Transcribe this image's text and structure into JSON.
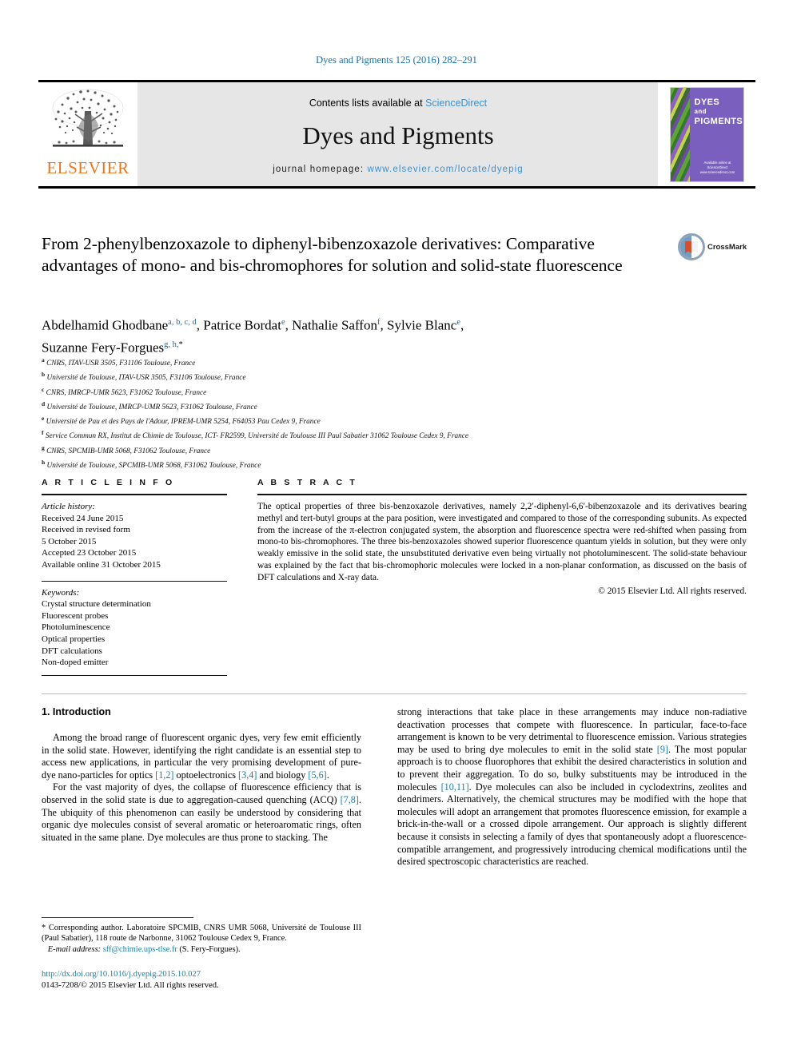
{
  "running_head": "Dyes and Pigments 125 (2016) 282–291",
  "masthead": {
    "publisher": "ELSEVIER",
    "contents_prefix": "Contents lists available at ",
    "contents_link": "ScienceDirect",
    "journal_name": "Dyes and Pigments",
    "homepage_prefix": "journal homepage: ",
    "homepage_url": "www.elsevier.com/locate/dyepig",
    "cover": {
      "line1": "DYES",
      "line2": "and",
      "line3": "PIGMENTS",
      "footer": "Available online at\nScienceDirect\nwww.sciencedirect.com"
    }
  },
  "article": {
    "title": "From 2-phenylbenzoxazole to diphenyl-bibenzoxazole derivatives: Comparative advantages of mono- and bis-chromophores for solution and solid-state fluorescence",
    "crossmark_label": "CrossMark",
    "authors_line1": "Abdelhamid Ghodbane",
    "authors_sup1": "a, b, c, d",
    "authors_line2": "Patrice Bordat",
    "authors_sup2": "e",
    "authors_line3": "Nathalie Saffon",
    "authors_sup3": "f",
    "authors_line4": "Sylvie Blanc",
    "authors_sup4": "e",
    "authors_line5": "Suzanne Fery-Forgues",
    "authors_sup5": "g, h,",
    "affiliations": [
      {
        "mark": "a",
        "text": "CNRS, ITAV-USR 3505, F31106 Toulouse, France"
      },
      {
        "mark": "b",
        "text": "Université de Toulouse, ITAV-USR 3505, F31106 Toulouse, France"
      },
      {
        "mark": "c",
        "text": "CNRS, IMRCP-UMR 5623, F31062 Toulouse, France"
      },
      {
        "mark": "d",
        "text": "Université de Toulouse, IMRCP-UMR 5623, F31062 Toulouse, France"
      },
      {
        "mark": "e",
        "text": "Université de Pau et des Pays de l'Adour, IPREM-UMR 5254, F64053 Pau Cedex 9, France"
      },
      {
        "mark": "f",
        "text": "Service Commun RX, Institut de Chimie de Toulouse, ICT- FR2599, Université de Toulouse III Paul Sabatier 31062 Toulouse Cedex 9, France"
      },
      {
        "mark": "g",
        "text": "CNRS, SPCMIB-UMR 5068, F31062 Toulouse, France"
      },
      {
        "mark": "h",
        "text": "Université de Toulouse, SPCMIB-UMR 5068, F31062 Toulouse, France"
      }
    ]
  },
  "article_info": {
    "heading": "A R T I C L E  I N F O",
    "history_title": "Article history:",
    "history": [
      "Received 24 June 2015",
      "Received in revised form",
      "5 October 2015",
      "Accepted 23 October 2015",
      "Available online 31 October 2015"
    ],
    "keywords_title": "Keywords:",
    "keywords": [
      "Crystal structure determination",
      "Fluorescent probes",
      "Photoluminescence",
      "Optical properties",
      "DFT calculations",
      "Non-doped emitter"
    ]
  },
  "abstract": {
    "heading": "A B S T R A C T",
    "text": "The optical properties of three bis-benzoxazole derivatives, namely 2,2′-diphenyl-6,6′-bibenzoxazole and its derivatives bearing methyl and tert-butyl groups at the para position, were investigated and compared to those of the corresponding subunits. As expected from the increase of the π-electron conjugated system, the absorption and fluorescence spectra were red-shifted when passing from mono-to bis-chromophores. The three bis-benzoxazoles showed superior fluorescence quantum yields in solution, but they were only weakly emissive in the solid state, the unsubstituted derivative even being virtually not photoluminescent. The solid-state behaviour was explained by the fact that bis-chromophoric molecules were locked in a non-planar conformation, as discussed on the basis of DFT calculations and X-ray data.",
    "copyright": "© 2015 Elsevier Ltd. All rights reserved."
  },
  "body": {
    "section_heading": "1.  Introduction",
    "left_p1_a": "Among the broad range of fluorescent organic dyes, very few emit efficiently in the solid state. However, identifying the right candidate is an essential step to access new applications, in particular the very promising development of pure-dye nano-particles for optics ",
    "left_p1_r1": "[1,2]",
    "left_p1_b": " optoelectronics ",
    "left_p1_r2": "[3,4]",
    "left_p1_c": " and biology ",
    "left_p1_r3": "[5,6]",
    "left_p1_d": ".",
    "left_p2_a": "For the vast majority of dyes, the collapse of fluorescence efficiency that is observed in the solid state is due to aggregation-caused quenching (ACQ) ",
    "left_p2_r1": "[7,8]",
    "left_p2_b": ". The ubiquity of this phenomenon can easily be understood by considering that organic dye molecules consist of several aromatic or heteroaromatic rings, often situated in the same plane. Dye molecules are thus prone to stacking. The",
    "right_p1_a": "strong interactions that take place in these arrangements may induce non-radiative deactivation processes that compete with fluorescence. In particular, face-to-face arrangement is known to be very detrimental to fluorescence emission. Various strategies may be used to bring dye molecules to emit in the solid state ",
    "right_p1_r1": "[9]",
    "right_p1_b": ". The most popular approach is to choose fluorophores that exhibit the desired characteristics in solution and to prevent their aggregation. To do so, bulky substituents may be introduced in the molecules ",
    "right_p1_r2": "[10,11]",
    "right_p1_c": ". Dye molecules can also be included in cyclodextrins, zeolites and dendrimers. Alternatively, the chemical structures may be modified with the hope that molecules will adopt an arrangement that promotes fluorescence emission, for example a brick-in-the-wall or a crossed dipole arrangement. Our approach is slightly different because it consists in selecting a family of dyes that spontaneously adopt a fluorescence-compatible arrangement, and progressively introducing chemical modifications until the desired spectroscopic characteristics are reached."
  },
  "footer": {
    "corresponding_marker": "*",
    "corresponding": " Corresponding author. Laboratoire SPCMIB, CNRS UMR 5068, Université de Toulouse III (Paul Sabatier), 118 route de Narbonne, 31062 Toulouse Cedex 9, France.",
    "email_label": "E-mail address:",
    "email": "sff@chimie.ups-tlse.fr",
    "email_suffix": " (S. Fery-Forgues).",
    "doi": "http://dx.doi.org/10.1016/j.dyepig.2015.10.027",
    "issn_line": "0143-7208/© 2015 Elsevier Ltd. All rights reserved."
  },
  "colors": {
    "link": "#1a7fa8",
    "elsevier_orange": "#E87722",
    "cover_purple": "#7a5fbf"
  }
}
